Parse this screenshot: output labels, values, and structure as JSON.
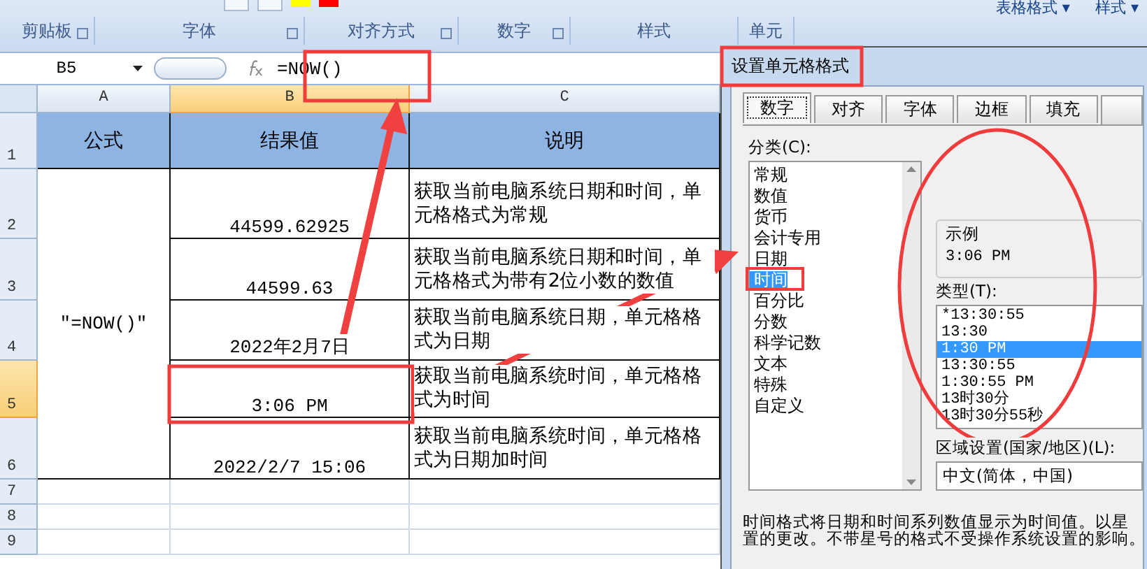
{
  "ribbon": {
    "top_buttons": [
      "表格格式 ▾",
      "样式 ▾"
    ],
    "groups": [
      {
        "label": "剪贴板",
        "launcher": true
      },
      {
        "label": "字体",
        "launcher": true
      },
      {
        "label": "对齐方式",
        "launcher": true
      },
      {
        "label": "数字",
        "launcher": true
      },
      {
        "label": "样式",
        "launcher": false
      },
      {
        "label": "单元",
        "launcher": false
      }
    ]
  },
  "formula_bar": {
    "name_box": "B5",
    "formula": "=NOW()"
  },
  "sheet": {
    "columns": [
      {
        "label": "A",
        "selected": false
      },
      {
        "label": "B",
        "selected": true
      },
      {
        "label": "C",
        "selected": false
      }
    ],
    "rows": [
      {
        "label": "1",
        "selected": false
      },
      {
        "label": "2",
        "selected": false
      },
      {
        "label": "3",
        "selected": false
      },
      {
        "label": "4",
        "selected": false
      },
      {
        "label": "5",
        "selected": true
      },
      {
        "label": "6",
        "selected": false
      },
      {
        "label": "7",
        "selected": false
      },
      {
        "label": "8",
        "selected": false
      },
      {
        "label": "9",
        "selected": false
      }
    ],
    "header": [
      "公式",
      "结果值",
      "说明"
    ],
    "formula_cell": "″=NOW()″",
    "records": [
      {
        "value": "44599.62925",
        "note": "获取当前电脑系统日期和时间，单元格格式为常规"
      },
      {
        "value": "44599.63",
        "note": "获取当前电脑系统日期和时间，单元格格式为带有2位小数的数值"
      },
      {
        "value": "2022年2月7日",
        "note": "获取当前电脑系统日期，单元格格式为日期"
      },
      {
        "value": "3:06 PM",
        "note": "获取当前电脑系统时间，单元格格式为时间"
      },
      {
        "value": "2022/2/7 15:06",
        "note": "获取当前电脑系统时间，单元格格式为日期加时间"
      }
    ]
  },
  "dialog": {
    "title": "设置单元格格式",
    "tabs": [
      {
        "label": "数字",
        "selected": true
      },
      {
        "label": "对齐",
        "selected": false
      },
      {
        "label": "字体",
        "selected": false
      },
      {
        "label": "边框",
        "selected": false
      },
      {
        "label": "填充",
        "selected": false
      }
    ],
    "category_label": "分类(C):",
    "categories": [
      {
        "label": "常规",
        "selected": false
      },
      {
        "label": "数值",
        "selected": false
      },
      {
        "label": "货币",
        "selected": false
      },
      {
        "label": "会计专用",
        "selected": false
      },
      {
        "label": "日期",
        "selected": false
      },
      {
        "label": "时间",
        "selected": true
      },
      {
        "label": "百分比",
        "selected": false
      },
      {
        "label": "分数",
        "selected": false
      },
      {
        "label": "科学记数",
        "selected": false
      },
      {
        "label": "文本",
        "selected": false
      },
      {
        "label": "特殊",
        "selected": false
      },
      {
        "label": "自定义",
        "selected": false
      }
    ],
    "sample_label": "示例",
    "sample_value": "3:06 PM",
    "type_label": "类型(T):",
    "types": [
      {
        "label": "*13:30:55",
        "selected": false
      },
      {
        "label": "13:30",
        "selected": false
      },
      {
        "label": "1:30 PM",
        "selected": true
      },
      {
        "label": "13:30:55",
        "selected": false
      },
      {
        "label": "1:30:55 PM",
        "selected": false
      },
      {
        "label": "13时30分",
        "selected": false
      },
      {
        "label": "13时30分55秒",
        "selected": false
      }
    ],
    "locale_label": "区域设置(国家/地区)(L):",
    "locale_value": "中文(简体，中国)",
    "description": [
      "时间格式将日期和时间系列数值显示为时间值。以星",
      "置的更改。不带星号的格式不受操作系统设置的影响。"
    ]
  }
}
